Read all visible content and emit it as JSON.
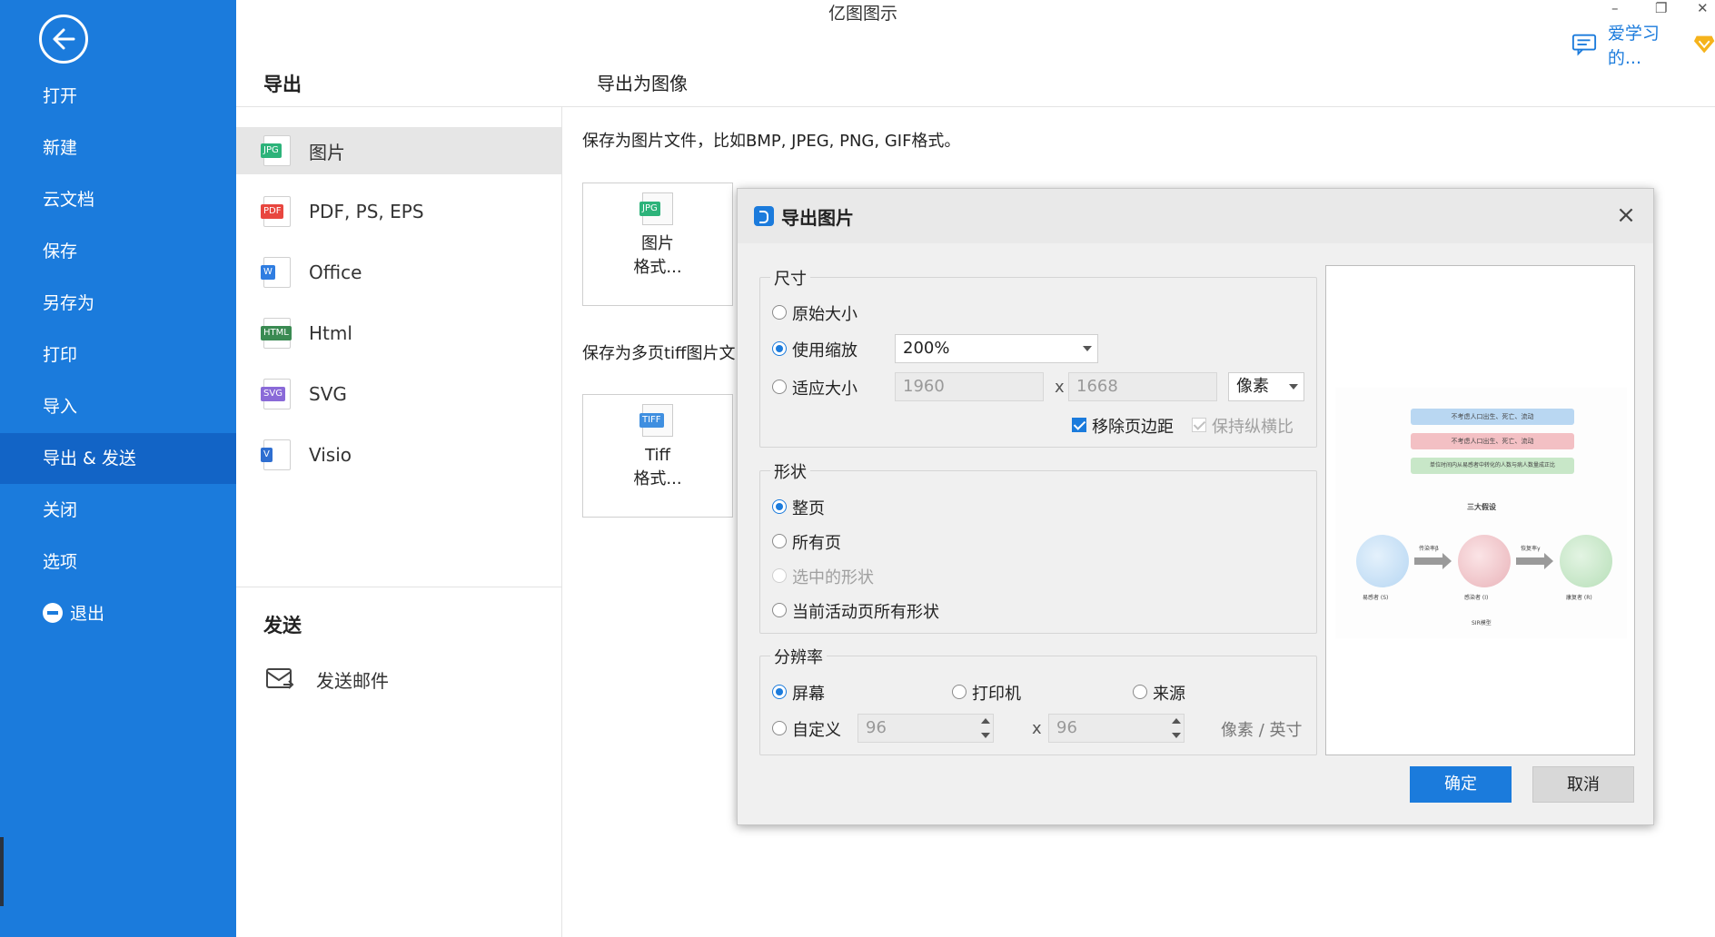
{
  "app": {
    "title": "亿图图示",
    "minimize": "–",
    "restore": "❐",
    "close": "✕",
    "user_name": "爱学习的..."
  },
  "sidebar": {
    "items": [
      {
        "label": "打开"
      },
      {
        "label": "新建"
      },
      {
        "label": "云文档"
      },
      {
        "label": "保存"
      },
      {
        "label": "另存为"
      },
      {
        "label": "打印"
      },
      {
        "label": "导入"
      },
      {
        "label": "导出 & 发送",
        "active": true
      },
      {
        "label": "关闭"
      },
      {
        "label": "选项"
      },
      {
        "label": "退出"
      }
    ]
  },
  "export": {
    "title": "导出",
    "formats": [
      {
        "label": "图片",
        "icon": "jpg-file-icon",
        "tag": "JPG",
        "color": "#2db37a"
      },
      {
        "label": "PDF, PS, EPS",
        "icon": "pdf-file-icon",
        "tag": "PDF",
        "color": "#e8463f"
      },
      {
        "label": "Office",
        "icon": "word-file-icon",
        "tag": "W",
        "color": "#2f7de1"
      },
      {
        "label": "Html",
        "icon": "html-file-icon",
        "tag": "HTML",
        "color": "#3a8a52"
      },
      {
        "label": "SVG",
        "icon": "svg-file-icon",
        "tag": "SVG",
        "color": "#8a6ad8"
      },
      {
        "label": "Visio",
        "icon": "visio-file-icon",
        "tag": "V",
        "color": "#2f6fd1"
      }
    ],
    "send_title": "发送",
    "send_mail": "发送邮件"
  },
  "main": {
    "heading": "导出为图像",
    "desc1": "保存为图片文件，比如BMP, JPEG, PNG, GIF格式。",
    "card1": {
      "tag": "JPG",
      "line1": "图片",
      "line2": "格式..."
    },
    "desc2": "保存为多页tiff图片文",
    "card2": {
      "tag": "TIFF",
      "line1": "Tiff",
      "line2": "格式..."
    }
  },
  "dialog": {
    "title": "导出图片",
    "close": "×",
    "size": {
      "legend": "尺寸",
      "original": "原始大小",
      "use_scale": "使用缩放",
      "scale_value": "200%",
      "fit": "适应大小",
      "width": "1960",
      "x": "x",
      "height": "1668",
      "unit": "像素",
      "remove_margin": "移除页边距",
      "keep_ratio": "保持纵横比"
    },
    "shape": {
      "legend": "形状",
      "whole_page": "整页",
      "all_pages": "所有页",
      "selected": "选中的形状",
      "current_all": "当前活动页所有形状"
    },
    "resolution": {
      "legend": "分辨率",
      "screen": "屏幕",
      "printer": "打印机",
      "source": "来源",
      "custom": "自定义",
      "dpi_x": "96",
      "x": "x",
      "dpi_y": "96",
      "unit": "像素 / 英寸"
    },
    "preview": {
      "bar1": "不考虑人口出生、死亡、流动",
      "bar2": "不考虑人口出生、死亡、流动",
      "bar3": "单位时间内从易感者中转化的人数与病人数量成正比",
      "title": "三大假设",
      "arrow1": "传染率β",
      "arrow2": "恢复率γ",
      "c1": "易感者 (S)",
      "c2": "感染者 (I)",
      "c3": "康复者 (R)",
      "footer": "SIR模型"
    },
    "ok": "确定",
    "cancel": "取消"
  },
  "colors": {
    "sidebar": "#1b7bdc",
    "sidebar_active": "#1264c6",
    "accent": "#1b7bdc"
  }
}
